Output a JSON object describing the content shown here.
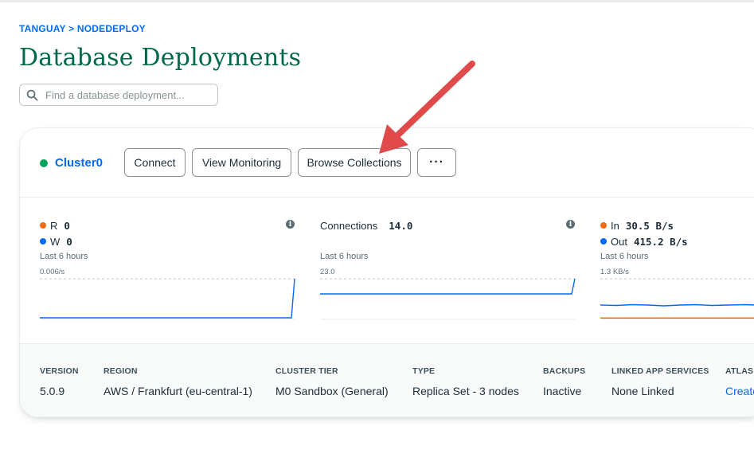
{
  "breadcrumb": {
    "org": "TANGUAY",
    "separator": ">",
    "project": "NODEDEPLOY"
  },
  "page": {
    "title": "Database Deployments"
  },
  "search": {
    "placeholder": "Find a database deployment..."
  },
  "cluster": {
    "name": "Cluster0",
    "status_color": "#00a35c",
    "buttons": {
      "connect": "Connect",
      "monitoring": "View Monitoring",
      "browse": "Browse Collections",
      "more": "···"
    }
  },
  "metrics": {
    "ops": {
      "r_label": "R",
      "r_value": "0",
      "r_color": "#ed6c19",
      "w_label": "W",
      "w_value": "0",
      "w_color": "#016bf8",
      "period": "Last 6 hours",
      "max": "0.006/s"
    },
    "connections": {
      "label": "Connections",
      "value": "14.0",
      "period": "Last 6 hours",
      "max": "23.0"
    },
    "network": {
      "in_label": "In",
      "in_value": "30.5 B/s",
      "in_color": "#ed6c19",
      "out_label": "Out",
      "out_value": "415.2 B/s",
      "out_color": "#016bf8",
      "period": "Last 6 hours",
      "max": "1.3 KB/s"
    }
  },
  "details": {
    "version": {
      "label": "VERSION",
      "value": "5.0.9"
    },
    "region": {
      "label": "REGION",
      "value": "AWS / Frankfurt (eu-central-1)"
    },
    "tier": {
      "label": "CLUSTER TIER",
      "value": "M0 Sandbox (General)"
    },
    "type": {
      "label": "TYPE",
      "value": "Replica Set - 3 nodes"
    },
    "backups": {
      "label": "BACKUPS",
      "value": "Inactive"
    },
    "linked": {
      "label": "LINKED APP SERVICES",
      "value": "None Linked"
    },
    "atlas": {
      "label": "ATLAS S",
      "value": "Create"
    }
  },
  "annotation": {
    "arrow_color": "#e04a4a"
  }
}
